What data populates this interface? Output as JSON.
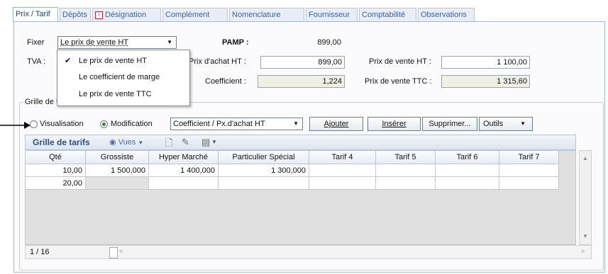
{
  "tabs": [
    {
      "label": "Prix / Tarif",
      "active": true
    },
    {
      "label": "Dépôts"
    },
    {
      "label": "Désignation",
      "icon": "document-icon"
    },
    {
      "label": "Complément"
    },
    {
      "label": "Nomenclature"
    },
    {
      "label": "Fournisseur"
    },
    {
      "label": "Comptabilité"
    },
    {
      "label": "Observations"
    }
  ],
  "form": {
    "fixer_label": "Fixer",
    "fixer_value": "Le prix de vente HT",
    "tva_label": "TVA :",
    "pamp_label": "PAMP :",
    "pamp_value": "899,00",
    "prix_achat_label": "Prix d'achat HT :",
    "prix_achat_value": "899,00",
    "coefficient_label": "Coefficient :",
    "coefficient_value": "1,224",
    "prix_vente_ht_label": "Prix de vente HT :",
    "prix_vente_ht_value": "1 100,00",
    "prix_vente_ttc_label": "Prix de vente TTC :",
    "prix_vente_ttc_value": "1 315,60"
  },
  "dropdown": {
    "items": [
      {
        "label": "Le prix de vente HT",
        "checked": true
      },
      {
        "label": "Le coefficient de marge"
      },
      {
        "label": "Le prix de vente TTC"
      }
    ]
  },
  "grille": {
    "legend": "Grille de tarifs",
    "radio_visualisation": "Visualisation",
    "radio_modification": "Modification",
    "mode_selected": "Modification",
    "combo_value": "Coefficient / Px.d'achat HT",
    "btn_ajouter": "Ajouter",
    "btn_inserer": "Insérer",
    "btn_supprimer": "Supprimer...",
    "btn_outils": "Outils",
    "toolbar_title": "Grille de tarifs",
    "toolbar_vues": "Vues",
    "columns": [
      "Qté",
      "Grossiste",
      "Hyper Marché",
      "Particulier Spécial",
      "Tarif 4",
      "Tarif 5",
      "Tarif 6",
      "Tarif 7"
    ],
    "rows": [
      [
        "10,00",
        "1 500,000",
        "1 400,000",
        "1 300,000",
        "",
        "",
        "",
        ""
      ],
      [
        "20,00",
        "",
        "",
        "",
        "",
        "",
        "",
        ""
      ]
    ],
    "pager": "1 / 16"
  },
  "colors": {
    "tab_text": "#3a63a8",
    "toolbar_title": "#2a4f8c",
    "readonly_bg": "#efefe4"
  }
}
